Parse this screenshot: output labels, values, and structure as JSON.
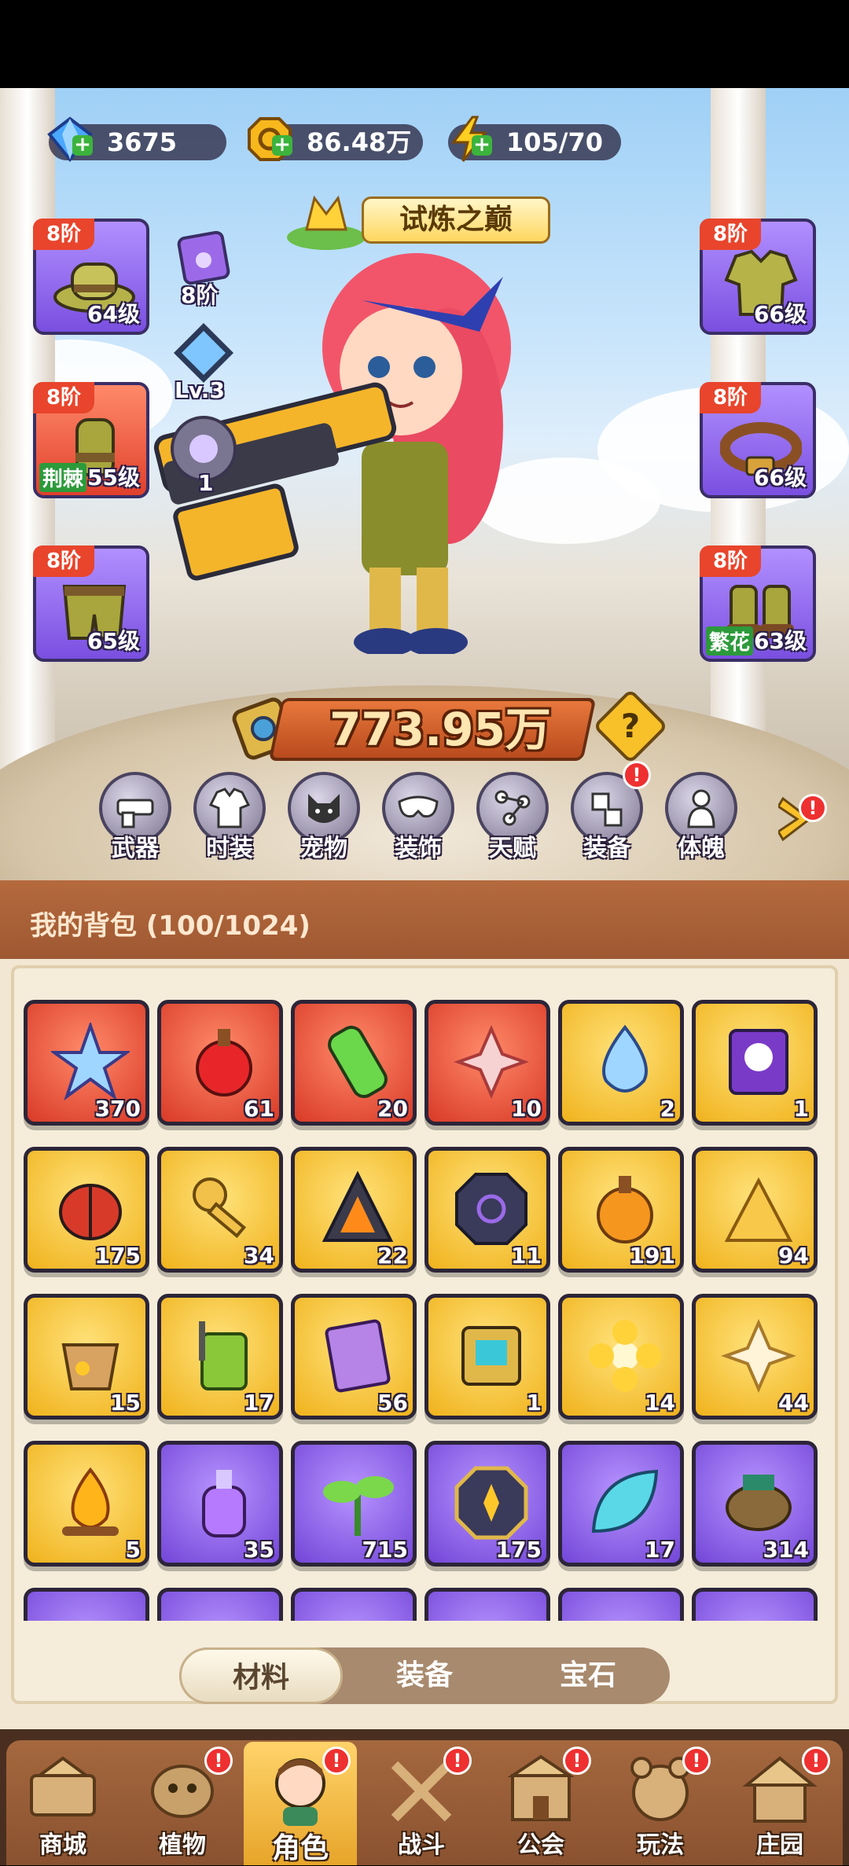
{
  "resources": [
    {
      "icon": "diamond-icon",
      "value": "3675"
    },
    {
      "icon": "gold-coin-icon",
      "value": "86.48万"
    },
    {
      "icon": "lightning-icon",
      "value": "105/70"
    }
  ],
  "event_banner": {
    "label": "试炼之巅"
  },
  "gear_left": [
    {
      "tier": "8阶",
      "level": "64级",
      "tag": "",
      "icon": "hat-icon",
      "rarity": "purple"
    },
    {
      "tier": "8阶",
      "level": "55级",
      "tag": "荆棘",
      "icon": "gloves-icon",
      "rarity": "red"
    },
    {
      "tier": "8阶",
      "level": "65级",
      "tag": "",
      "icon": "shorts-icon",
      "rarity": "purple"
    }
  ],
  "gear_right": [
    {
      "tier": "8阶",
      "level": "66级",
      "tag": "",
      "icon": "jacket-icon",
      "rarity": "purple"
    },
    {
      "tier": "8阶",
      "level": "66级",
      "tag": "",
      "icon": "belt-icon",
      "rarity": "purple"
    },
    {
      "tier": "8阶",
      "level": "63级",
      "tag": "繁花",
      "icon": "boots-icon",
      "rarity": "purple"
    }
  ],
  "middle_slots": [
    {
      "icon": "paw-scroll-icon",
      "label": "8阶"
    },
    {
      "icon": "crystal-icon",
      "label": "Lv.3"
    },
    {
      "icon": "orb-icon",
      "label": "1"
    }
  ],
  "combat_power": "773.95万",
  "help_label": "?",
  "menu": [
    {
      "label": "武器",
      "icon": "weapon-icon",
      "badge": ""
    },
    {
      "label": "时装",
      "icon": "costume-icon",
      "badge": ""
    },
    {
      "label": "宠物",
      "icon": "pet-icon",
      "badge": ""
    },
    {
      "label": "装饰",
      "icon": "mask-icon",
      "badge": ""
    },
    {
      "label": "天赋",
      "icon": "talent-icon",
      "badge": ""
    },
    {
      "label": "装备",
      "icon": "equipment-icon",
      "badge": "!"
    },
    {
      "label": "体魄",
      "icon": "physique-icon",
      "badge": ""
    }
  ],
  "menu_more_badge": "!",
  "bag": {
    "title": "我的背包 (100/1024)",
    "items": [
      {
        "rarity": "red",
        "icon": "star-crystal-icon",
        "count": "370"
      },
      {
        "rarity": "red",
        "icon": "red-potion-icon",
        "count": "61"
      },
      {
        "rarity": "red",
        "icon": "green-tube-icon",
        "count": "20"
      },
      {
        "rarity": "red",
        "icon": "knot-emblem-icon",
        "count": "10"
      },
      {
        "rarity": "gold",
        "icon": "water-drop-icon",
        "count": "2"
      },
      {
        "rarity": "gold",
        "icon": "skull-scroll-icon",
        "count": "1"
      },
      {
        "rarity": "gold",
        "icon": "ladybug-icon",
        "count": "175"
      },
      {
        "rarity": "gold",
        "icon": "key-icon",
        "count": "34"
      },
      {
        "rarity": "gold",
        "icon": "fire-shard-icon",
        "count": "22"
      },
      {
        "rarity": "gold",
        "icon": "rune-stone-icon",
        "count": "11"
      },
      {
        "rarity": "gold",
        "icon": "orange-potion-icon",
        "count": "191"
      },
      {
        "rarity": "gold",
        "icon": "gold-powder-icon",
        "count": "94"
      },
      {
        "rarity": "gold",
        "icon": "flower-pot-icon",
        "count": "15"
      },
      {
        "rarity": "gold",
        "icon": "sprayer-icon",
        "count": "17"
      },
      {
        "rarity": "gold",
        "icon": "book-icon",
        "count": "56"
      },
      {
        "rarity": "gold",
        "icon": "chip-icon",
        "count": "1"
      },
      {
        "rarity": "gold",
        "icon": "yellow-flower-icon",
        "count": "14"
      },
      {
        "rarity": "gold",
        "icon": "knot-emblem-gold-icon",
        "count": "44"
      },
      {
        "rarity": "gold",
        "icon": "campfire-icon",
        "count": "5"
      },
      {
        "rarity": "purple",
        "icon": "purple-potion-icon",
        "count": "35"
      },
      {
        "rarity": "purple",
        "icon": "sprout-icon",
        "count": "715"
      },
      {
        "rarity": "purple",
        "icon": "badge-emblem-icon",
        "count": "175"
      },
      {
        "rarity": "purple",
        "icon": "cyan-leaf-icon",
        "count": "17"
      },
      {
        "rarity": "purple",
        "icon": "log-icon",
        "count": "314"
      },
      {
        "rarity": "purple",
        "icon": "",
        "count": ""
      },
      {
        "rarity": "purple",
        "icon": "",
        "count": ""
      },
      {
        "rarity": "purple",
        "icon": "",
        "count": ""
      },
      {
        "rarity": "purple",
        "icon": "",
        "count": ""
      },
      {
        "rarity": "purple",
        "icon": "",
        "count": ""
      },
      {
        "rarity": "purple",
        "icon": "",
        "count": ""
      }
    ]
  },
  "bag_tabs": [
    {
      "label": "材料",
      "active": true
    },
    {
      "label": "装备",
      "active": false
    },
    {
      "label": "宝石",
      "active": false
    }
  ],
  "nav": [
    {
      "label": "商城",
      "icon": "shop-icon",
      "badge": "",
      "active": false
    },
    {
      "label": "植物",
      "icon": "plant-icon",
      "badge": "!",
      "active": false
    },
    {
      "label": "角色",
      "icon": "character-icon",
      "badge": "!",
      "active": true
    },
    {
      "label": "战斗",
      "icon": "battle-icon",
      "badge": "!",
      "active": false
    },
    {
      "label": "公会",
      "icon": "guild-icon",
      "badge": "!",
      "active": false
    },
    {
      "label": "玩法",
      "icon": "gameplay-icon",
      "badge": "!",
      "active": false
    },
    {
      "label": "庄园",
      "icon": "manor-icon",
      "badge": "!",
      "active": false
    }
  ],
  "colors": {
    "red_rarity": "#e0402c",
    "gold_rarity": "#f0b21c",
    "purple_rarity": "#7a4fe0",
    "panel": "#f2e7d2",
    "bag_header": "#a55f36"
  }
}
